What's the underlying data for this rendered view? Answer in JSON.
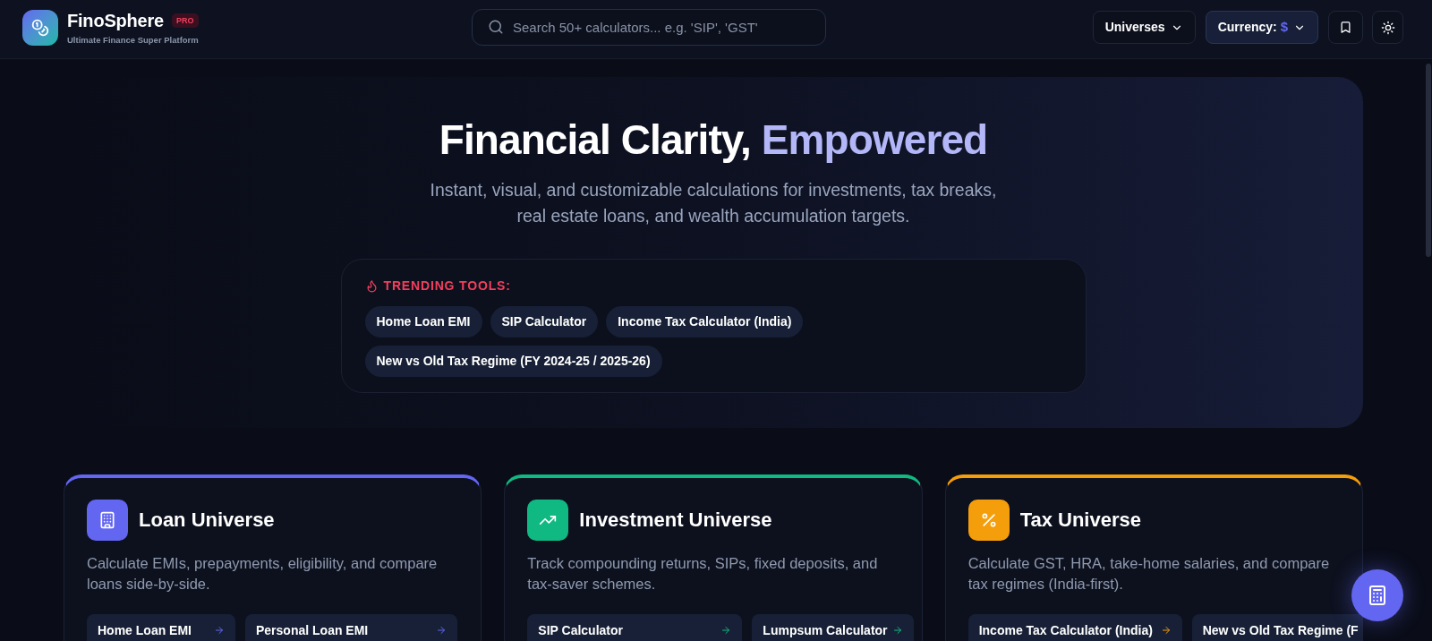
{
  "header": {
    "brand": {
      "name": "FinoSphere",
      "badge": "PRO",
      "tagline": "Ultimate Finance Super Platform"
    },
    "search": {
      "placeholder": "Search 50+ calculators... e.g. 'SIP', 'GST'"
    },
    "universes_menu": {
      "label": "Universes"
    },
    "currency_menu": {
      "label": "Currency:",
      "symbol": "$"
    }
  },
  "hero": {
    "title": "Financial Clarity,",
    "title_highlight": "Empowered",
    "subtitle_lines": [
      "Instant, visual, and customizable calculations for investments, tax breaks,",
      "real estate loans, and wealth accumulation targets."
    ],
    "trending": {
      "label": "TRENDING TOOLS:",
      "tools": [
        "Home Loan EMI",
        "SIP Calculator",
        "Income Tax Calculator (India)",
        "New vs Old Tax Regime (FY 2024-25 / 2025-26)"
      ]
    }
  },
  "universes": [
    {
      "title": "Loan Universe",
      "color": "#6366f1",
      "description_lines": [
        "Calculate EMIs, prepayments, eligibility, and compare",
        "loans side-by-side."
      ],
      "tools": [
        {
          "label": "Home Loan EMI",
          "arrow": true
        },
        {
          "label": "Personal Loan EMI",
          "arrow": true
        }
      ]
    },
    {
      "title": "Investment Universe",
      "color": "#10b981",
      "description_lines": [
        "Track compounding returns, SIPs, fixed deposits, and",
        "tax-saver schemes."
      ],
      "tools": [
        {
          "label": "SIP Calculator",
          "arrow": true
        },
        {
          "label": "Lumpsum Calculator",
          "arrow": true
        }
      ]
    },
    {
      "title": "Tax Universe",
      "color": "#f59e0b",
      "description_lines": [
        "Calculate GST, HRA, take-home salaries, and compare",
        "tax regimes (India-first)."
      ],
      "tools": [
        {
          "label": "Income Tax Calculator (India)",
          "arrow": true
        },
        {
          "label": "New vs Old Tax Regime (F",
          "arrow": false
        }
      ]
    }
  ]
}
